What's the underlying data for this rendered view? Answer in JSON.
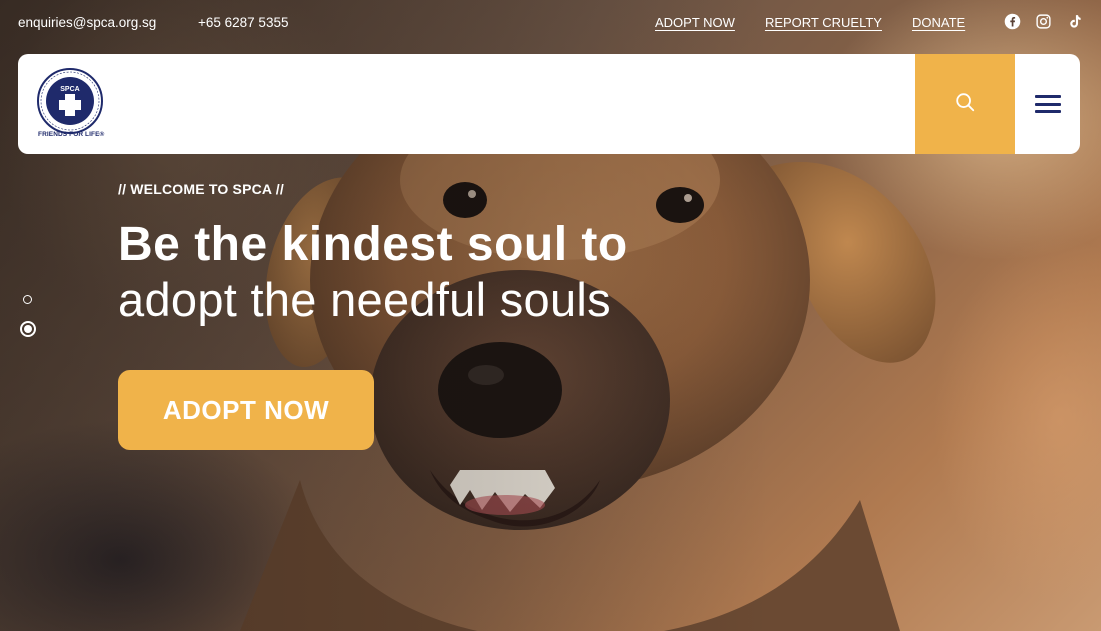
{
  "topbar": {
    "email": "enquiries@spca.org.sg",
    "phone": "+65 6287 5355",
    "links": [
      "ADOPT NOW",
      "REPORT CRUELTY",
      "DONATE"
    ],
    "socials": [
      "facebook-icon",
      "instagram-icon",
      "tiktok-icon"
    ]
  },
  "header": {
    "logo": {
      "ring_text": "BE KIND TO ANIMALS · SINGAPORE",
      "center_text": "SPCA",
      "tagline": "FRIENDS FOR LIFE®"
    },
    "search_icon": "search-icon",
    "menu_icon": "hamburger-menu-icon"
  },
  "hero": {
    "eyebrow": "// WELCOME TO SPCA //",
    "headline_bold": "Be the kindest soul to",
    "headline_regular": "adopt the needful souls",
    "cta_label": "ADOPT NOW",
    "slides_total": 2,
    "active_slide": 2
  },
  "colors": {
    "accent": "#f0b34a",
    "brand_navy": "#1f2a6b",
    "text_light": "#ffffff"
  }
}
